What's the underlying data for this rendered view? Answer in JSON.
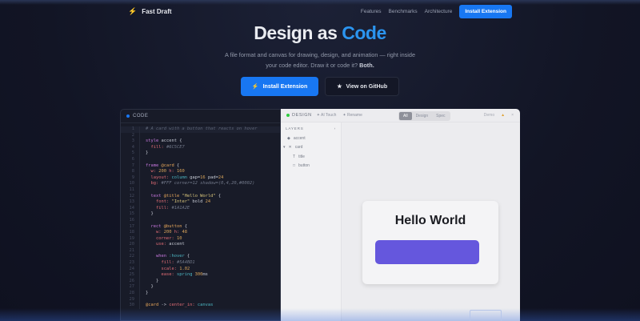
{
  "nav": {
    "brand": "Fast Draft",
    "links": [
      "Features",
      "Benchmarks",
      "Architecture"
    ],
    "cta": "Install Extension"
  },
  "hero": {
    "title_a": "Design as",
    "title_b": "Code",
    "sub_1": "A file format and canvas for drawing, design, and animation — right inside",
    "sub_2": "your code editor. Draw it or code it?",
    "sub_bold": "Both.",
    "primary": "Install Extension",
    "secondary": "View on GitHub"
  },
  "code": {
    "label": "CODE",
    "lines": [
      [
        [
          "cmt",
          "# A card with a button that reacts on hover"
        ]
      ],
      [],
      [
        [
          "kw",
          "style"
        ],
        [
          "pl",
          " accent {"
        ]
      ],
      [
        [
          "pl",
          "  "
        ],
        [
          "pr",
          "fill:"
        ],
        [
          "hx",
          " #6C5CE7"
        ]
      ],
      [
        [
          "pl",
          "}"
        ]
      ],
      [],
      [
        [
          "kw",
          "frame"
        ],
        [
          "pl",
          " "
        ],
        [
          "id",
          "@card"
        ],
        [
          "pl",
          " {"
        ]
      ],
      [
        [
          "pl",
          "  "
        ],
        [
          "pr",
          "w:"
        ],
        [
          "nm",
          " 200"
        ],
        [
          "pr",
          " h:"
        ],
        [
          "nm",
          " 160"
        ]
      ],
      [
        [
          "pl",
          "  "
        ],
        [
          "pr",
          "layout:"
        ],
        [
          "cy",
          " column"
        ],
        [
          "pl",
          " gap="
        ],
        [
          "nm",
          "16"
        ],
        [
          "pl",
          " pad="
        ],
        [
          "nm",
          "24"
        ]
      ],
      [
        [
          "pl",
          "  "
        ],
        [
          "pr",
          "bg:"
        ],
        [
          "hx",
          " #FFF corner=12 shadow=(0,4,20,#0002)"
        ]
      ],
      [],
      [
        [
          "pl",
          "  "
        ],
        [
          "kw",
          "text"
        ],
        [
          "pl",
          " "
        ],
        [
          "id",
          "@title"
        ],
        [
          "st",
          " \"Hello World\""
        ],
        [
          "pl",
          " {"
        ]
      ],
      [
        [
          "pl",
          "    "
        ],
        [
          "pr",
          "font:"
        ],
        [
          "st",
          " \"Inter\""
        ],
        [
          "pl",
          " bold "
        ],
        [
          "nm",
          "24"
        ]
      ],
      [
        [
          "pl",
          "    "
        ],
        [
          "pr",
          "fill:"
        ],
        [
          "hx",
          " #1A1A2E"
        ]
      ],
      [
        [
          "pl",
          "  }"
        ]
      ],
      [],
      [
        [
          "pl",
          "  "
        ],
        [
          "kw",
          "rect"
        ],
        [
          "pl",
          " "
        ],
        [
          "id",
          "@button"
        ],
        [
          "pl",
          " {"
        ]
      ],
      [
        [
          "pl",
          "    "
        ],
        [
          "pr",
          "w:"
        ],
        [
          "nm",
          " 200"
        ],
        [
          "pr",
          " h:"
        ],
        [
          "nm",
          " 48"
        ]
      ],
      [
        [
          "pl",
          "    "
        ],
        [
          "pr",
          "corner:"
        ],
        [
          "nm",
          " 10"
        ]
      ],
      [
        [
          "pl",
          "    "
        ],
        [
          "pr",
          "use:"
        ],
        [
          "pl",
          " accent"
        ]
      ],
      [],
      [
        [
          "pl",
          "    "
        ],
        [
          "kw",
          "when"
        ],
        [
          "cy",
          " :hover"
        ],
        [
          "pl",
          " {"
        ]
      ],
      [
        [
          "pl",
          "      "
        ],
        [
          "pr",
          "fill:"
        ],
        [
          "hx",
          " #5A4BD1"
        ]
      ],
      [
        [
          "pl",
          "      "
        ],
        [
          "pr",
          "scale:"
        ],
        [
          "nm",
          " 1.02"
        ]
      ],
      [
        [
          "pl",
          "      "
        ],
        [
          "pr",
          "ease:"
        ],
        [
          "cy",
          " spring"
        ],
        [
          "nm",
          " 300"
        ],
        [
          "pl",
          "ms"
        ]
      ],
      [
        [
          "pl",
          "    }"
        ]
      ],
      [
        [
          "pl",
          "  }"
        ]
      ],
      [
        [
          "pl",
          "}"
        ]
      ],
      [],
      [
        [
          "id",
          "@card"
        ],
        [
          "pl",
          " -> "
        ],
        [
          "pr",
          "center_in:"
        ],
        [
          "cy",
          " canvas"
        ]
      ]
    ]
  },
  "design": {
    "label": "DESIGN",
    "tags": [
      "AI Touch",
      "Rename"
    ],
    "segments": [
      "All",
      "Design",
      "Spec"
    ],
    "active_segment": "All",
    "right": "Demo",
    "layers_title": "LAYERS",
    "layers": [
      {
        "label": "accent",
        "icon": "diamond",
        "indent": 0
      },
      {
        "label": "card",
        "icon": "frame",
        "indent": 0,
        "expanded": true
      },
      {
        "label": "title",
        "icon": "text",
        "indent": 1
      },
      {
        "label": "button",
        "icon": "rect",
        "indent": 1
      }
    ],
    "card_title": "Hello World"
  },
  "colors": {
    "accent": "#1877f2",
    "title_blue": "#2b95f0",
    "button": "#6557dd",
    "status": "#2ecc40"
  }
}
